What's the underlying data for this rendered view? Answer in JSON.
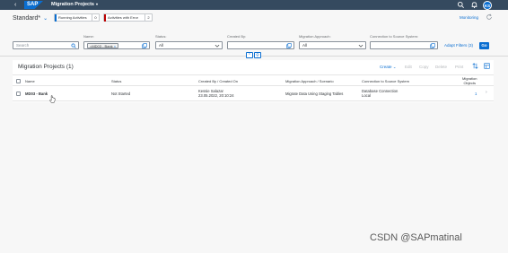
{
  "shell": {
    "app_title": "Migration Projects",
    "avatar_initials": "KS",
    "brand": "SAP",
    "bar_color": "#354a5f",
    "accent_color": "#0a6ed1"
  },
  "header": {
    "variant": "Standard",
    "variant_marker": "*",
    "running_label": "Running Activities",
    "running_count": "0",
    "running_color": "#0a6ed1",
    "error_label": "Activities with Error",
    "error_count": "2",
    "error_color": "#bb0000",
    "monitoring": "Monitoring"
  },
  "filters": {
    "search_placeholder": "Search",
    "name_label": "Name:",
    "name_token": "=MD03 - Bank",
    "status_label": "Status:",
    "status_value": "All",
    "created_by_label": "Created By:",
    "created_by_value": "",
    "approach_label": "Migration Approach:",
    "approach_value": "All",
    "connection_label": "Connection to Source System:",
    "connection_value": "",
    "adapt_filters": "Adapt Filters (3)",
    "go": "Go"
  },
  "table": {
    "title": "Migration Projects (1)",
    "toolbar": {
      "create": "Create",
      "edit": "Edit",
      "copy": "Copy",
      "delete": "Delete",
      "print": "Print"
    },
    "columns": {
      "name": "Name",
      "status": "Status",
      "created": "Created By / Created On",
      "approach": "Migration Approach / Scenario",
      "connection": "Connection to Source System",
      "objects_line1": "Migration",
      "objects_line2": "Objects"
    },
    "rows": [
      {
        "name": "MD03 - Bank",
        "status": "Not Started",
        "created_by": "Kessie Salazar",
        "created_on": "23.05.2022, 20:10:24",
        "approach": "Migrate Data Using Staging Tables",
        "connection_line1": "Database Connection",
        "connection_line2": "Local",
        "objects": "1"
      }
    ]
  },
  "watermark": "CSDN @SAPmatinal"
}
